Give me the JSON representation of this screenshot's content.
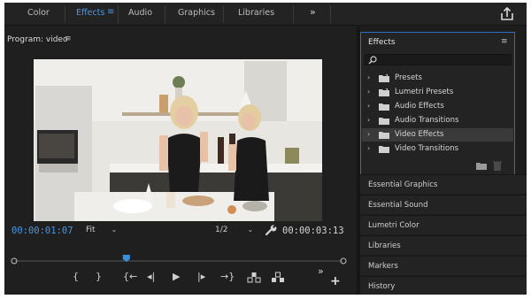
{
  "workspace": {
    "tabs": [
      {
        "label": "Color"
      },
      {
        "label": "Effects"
      },
      {
        "label": "Audio"
      },
      {
        "label": "Graphics"
      },
      {
        "label": "Libraries"
      }
    ],
    "active_tab": "Effects",
    "menu_icon": "hamburger-icon",
    "more_icon": "double-chevron-right-icon",
    "share_icon": "share-export-icon"
  },
  "program_monitor": {
    "title": "Program: video",
    "menu_glyph": "≡",
    "current_timecode": "00:00:01:07",
    "duration_timecode": "00:00:03:13",
    "zoom": "Fit",
    "resolution": "1/2",
    "playhead_position": 0.34,
    "transport_icons": [
      "mark-in-icon",
      "mark-out-icon",
      "go-to-in-icon",
      "step-back-icon",
      "play-icon",
      "step-forward-icon",
      "go-to-out-icon",
      "lift-icon",
      "extract-icon"
    ],
    "transport_glyphs": [
      "{",
      "}",
      "{←",
      "◂|",
      "▶",
      "|▸",
      "→}"
    ],
    "more_glyph": "»",
    "add_glyph": "+",
    "video_description_icon": "video-frame"
  },
  "effects_panel": {
    "title": "Effects",
    "menu_glyph": "≡",
    "search_placeholder": "",
    "items": [
      {
        "label": "Presets",
        "expander": "›",
        "selected": false
      },
      {
        "label": "Lumetri Presets",
        "expander": "›",
        "selected": false
      },
      {
        "label": "Audio Effects",
        "expander": "›",
        "selected": false
      },
      {
        "label": "Audio Transitions",
        "expander": "›",
        "selected": false
      },
      {
        "label": "Video Effects",
        "expander": "›",
        "selected": true
      },
      {
        "label": "Video Transitions",
        "expander": "›",
        "selected": false
      }
    ]
  },
  "panels": [
    {
      "label": "Essential Graphics"
    },
    {
      "label": "Essential Sound"
    },
    {
      "label": "Lumetri Color"
    },
    {
      "label": "Libraries"
    },
    {
      "label": "Markers"
    },
    {
      "label": "History"
    }
  ],
  "colors": {
    "accent": "#4d9ae6",
    "panel_bg": "#232323",
    "focus_border": "#2c6fc0"
  }
}
